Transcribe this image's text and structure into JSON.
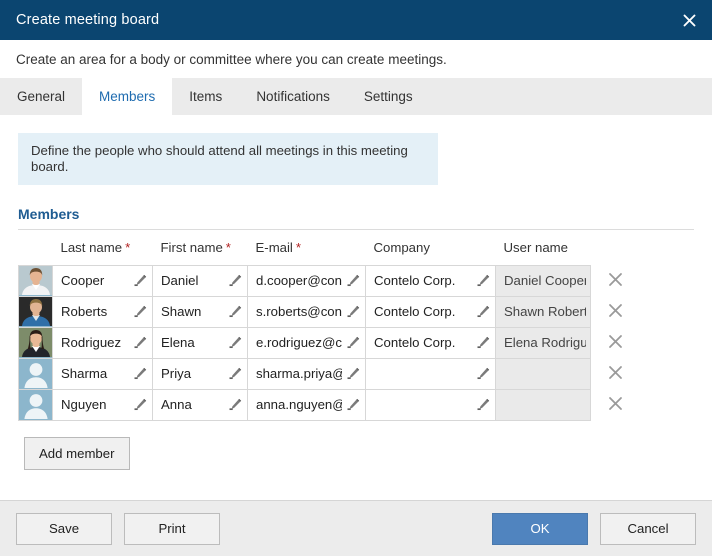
{
  "window": {
    "title": "Create meeting board",
    "close_icon": "close-icon",
    "subtitle": "Create an area for a body or committee where you can create meetings."
  },
  "tabs": [
    {
      "label": "General",
      "active": false
    },
    {
      "label": "Members",
      "active": true
    },
    {
      "label": "Items",
      "active": false
    },
    {
      "label": "Notifications",
      "active": false
    },
    {
      "label": "Settings",
      "active": false
    }
  ],
  "info_banner": {
    "text": "Define the people who should attend all meetings in this meeting board."
  },
  "section": {
    "title": "Members"
  },
  "table": {
    "columns": [
      {
        "label": "Last name",
        "required": true
      },
      {
        "label": "First name",
        "required": true
      },
      {
        "label": "E-mail",
        "required": true
      },
      {
        "label": "Company",
        "required": false
      },
      {
        "label": "User name",
        "required": false
      }
    ],
    "required_marker": "*",
    "edit_icon": "pencil-icon",
    "remove_icon": "close-icon",
    "rows": [
      {
        "avatar": "photo-avatar-male-1",
        "last_name": "Cooper",
        "first_name": "Daniel",
        "email": "d.cooper@cont",
        "company": "Contelo Corp.",
        "user_name": "Daniel Cooper"
      },
      {
        "avatar": "photo-avatar-male-2",
        "last_name": "Roberts",
        "first_name": "Shawn",
        "email": "s.roberts@cont",
        "company": "Contelo Corp.",
        "user_name": "Shawn Robert"
      },
      {
        "avatar": "photo-avatar-female-1",
        "last_name": "Rodriguez",
        "first_name": "Elena",
        "email": "e.rodriguez@co",
        "company": "Contelo Corp.",
        "user_name": "Elena Rodrigu"
      },
      {
        "avatar": "placeholder-avatar",
        "last_name": "Sharma",
        "first_name": "Priya",
        "email": "sharma.priya@",
        "company": "",
        "user_name": ""
      },
      {
        "avatar": "placeholder-avatar",
        "last_name": "Nguyen",
        "first_name": "Anna",
        "email": "anna.nguyen@",
        "company": "",
        "user_name": ""
      }
    ]
  },
  "actions": {
    "add_member": "Add member"
  },
  "footer": {
    "save": "Save",
    "print": "Print",
    "ok": "OK",
    "cancel": "Cancel"
  },
  "colors": {
    "titlebar": "#0b4570",
    "accent_blue": "#1f6cb0",
    "primary_button": "#5084bf",
    "info_banner": "#e4f0f7",
    "section_heading": "#1f5c92",
    "required_star": "#b02020",
    "readonly_cell": "#eaeaea"
  }
}
